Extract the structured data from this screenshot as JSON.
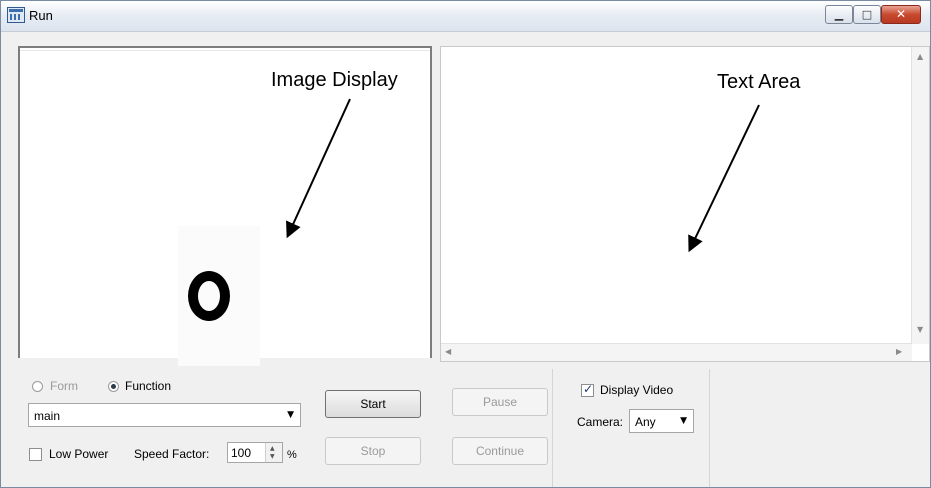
{
  "window": {
    "title": "Run",
    "icon": "run-window-icon",
    "controls": {
      "minimize_glyph": "▁",
      "maximize_glyph": "□",
      "close_glyph": "✕"
    }
  },
  "image_display": {
    "annotation_label": "Image Display",
    "content": "black ring shape"
  },
  "text_area": {
    "annotation_label": "Text Area",
    "content": "",
    "scroll_up_glyph": "▲",
    "scroll_down_glyph": "▼",
    "scroll_left_glyph": "◀",
    "scroll_right_glyph": "▶"
  },
  "mode": {
    "form_label": "Form",
    "function_label": "Function",
    "selected": "Function",
    "function_value": "main"
  },
  "low_power": {
    "label": "Low Power",
    "checked": false
  },
  "speed_factor": {
    "label": "Speed Factor:",
    "value": "100",
    "unit": "%"
  },
  "buttons": {
    "start": "Start",
    "stop": "Stop",
    "pause": "Pause",
    "continue": "Continue"
  },
  "display_video": {
    "label": "Display Video",
    "checked": true
  },
  "camera": {
    "label": "Camera:",
    "value": "Any"
  },
  "colors": {
    "close_button": "#c8492f",
    "titlebar": "#e8edf4",
    "panel_bg": "#f0f0f0"
  }
}
